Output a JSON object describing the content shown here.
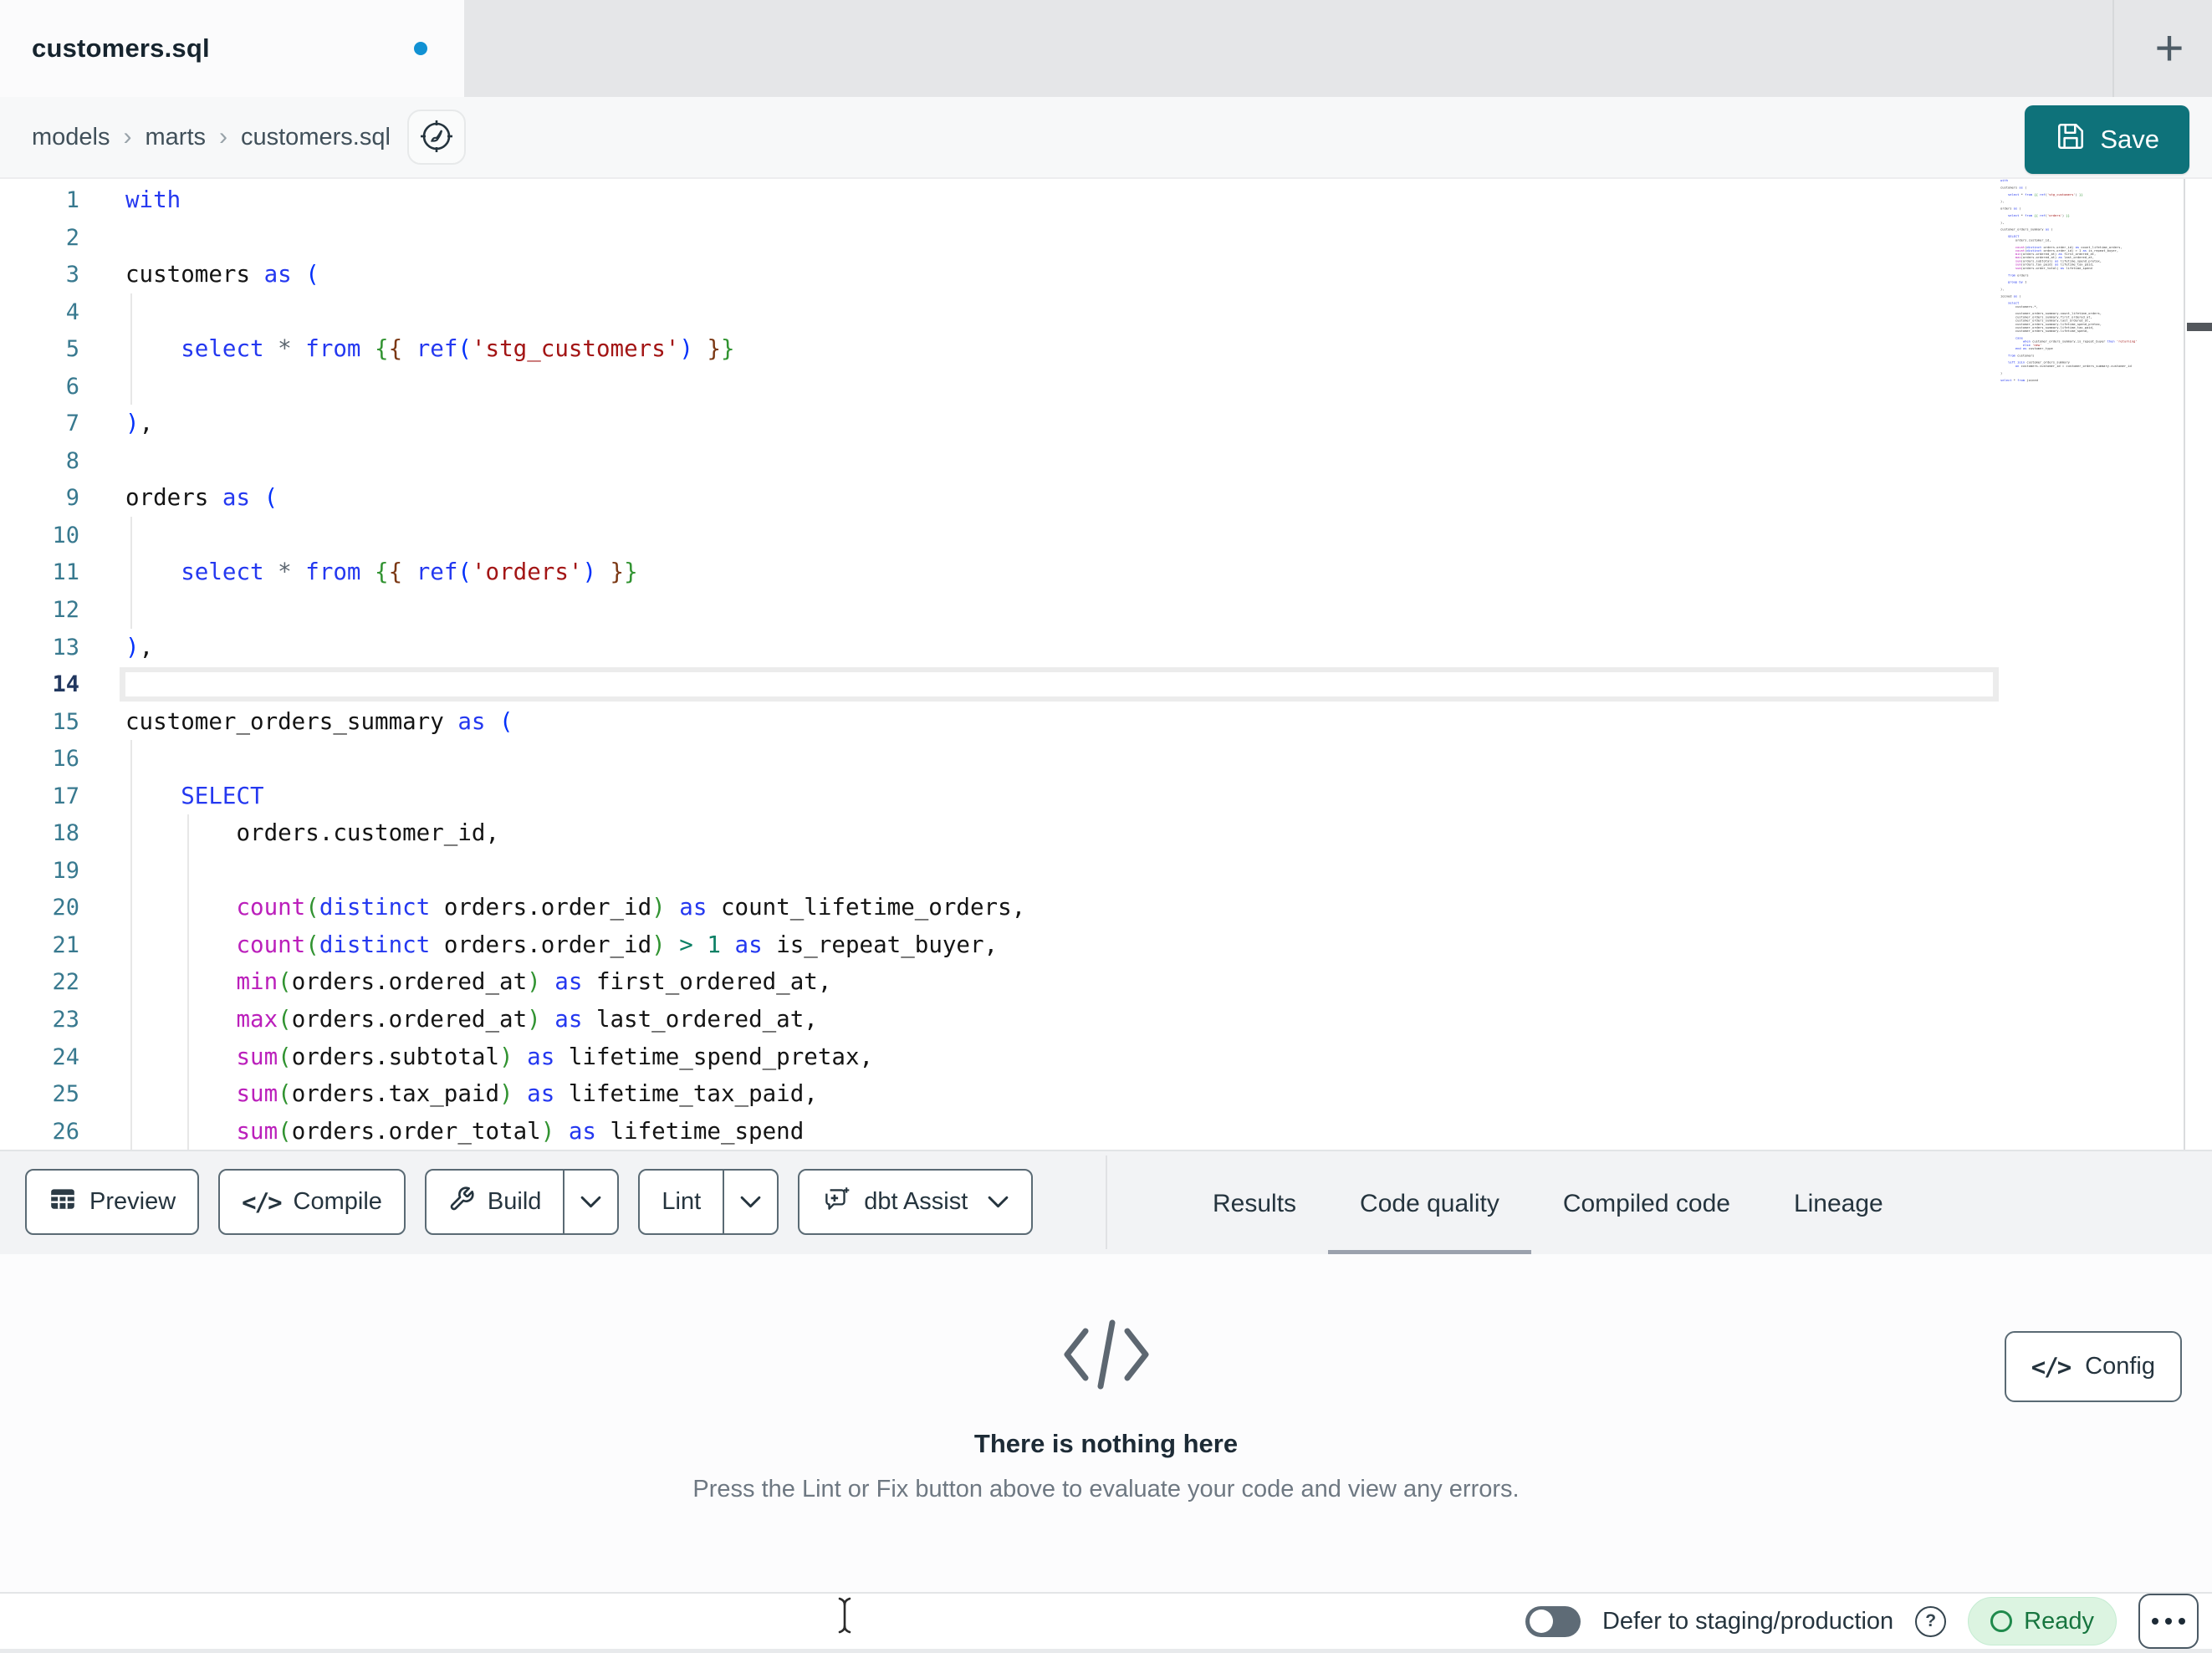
{
  "tab_bar": {
    "file_name": "customers.sql",
    "unsaved": true,
    "new_tab_label": "+"
  },
  "breadcrumb": {
    "items": [
      "models",
      "marts",
      "customers.sql"
    ],
    "separator": "›"
  },
  "actions": {
    "save": "Save",
    "config": "Config"
  },
  "toolbar": {
    "preview": "Preview",
    "compile": "Compile",
    "build": "Build",
    "lint": "Lint",
    "assist": "dbt Assist"
  },
  "panel_tabs": [
    {
      "label": "Results",
      "active": false
    },
    {
      "label": "Code quality",
      "active": true
    },
    {
      "label": "Compiled code",
      "active": false
    },
    {
      "label": "Lineage",
      "active": false
    }
  ],
  "empty_state": {
    "title": "There is nothing here",
    "description": "Press the Lint or Fix button above to evaluate your code and view any errors."
  },
  "status_bar": {
    "defer_label": "Defer to staging/production",
    "ready_label": "Ready",
    "toggle_on": false
  },
  "colors": {
    "accent_teal": "#0e727a",
    "unsaved_blue": "#1191d3",
    "ready_green": "#17753f",
    "ready_bg": "#dcf4e1",
    "line_number": "#38798f",
    "keyword": "#2438f0",
    "function": "#bb1fbb",
    "string": "#a31515",
    "jinja_bracket_green": "#319331",
    "bracket_blue": "#0431fa",
    "bracket_brown": "#7b3814",
    "active_tab_underline": "#9ba1ad"
  },
  "editor": {
    "current_line": 14,
    "lines": [
      {
        "n": 1,
        "g": [],
        "seg": [
          [
            "k",
            "with"
          ]
        ]
      },
      {
        "n": 2,
        "g": [],
        "seg": []
      },
      {
        "n": 3,
        "g": [],
        "seg": [
          [
            "p",
            "customers "
          ],
          [
            "k",
            "as"
          ],
          [
            "b1",
            " ("
          ]
        ]
      },
      {
        "n": 4,
        "g": [
          1
        ],
        "seg": []
      },
      {
        "n": 5,
        "g": [
          1
        ],
        "seg": [
          [
            "p",
            "    "
          ],
          [
            "k",
            "select"
          ],
          [
            "o",
            " *"
          ],
          [
            "k",
            " from"
          ],
          [
            "b2",
            " {"
          ],
          [
            "b3",
            "{"
          ],
          [
            "k",
            " ref"
          ],
          [
            "b1",
            "("
          ],
          [
            "s",
            "'stg_customers'"
          ],
          [
            "b1",
            ")"
          ],
          [
            "b3",
            " }"
          ],
          [
            "b2",
            "}"
          ]
        ]
      },
      {
        "n": 6,
        "g": [
          1
        ],
        "seg": []
      },
      {
        "n": 7,
        "g": [],
        "seg": [
          [
            "b1",
            ")"
          ],
          [
            "p",
            ","
          ]
        ]
      },
      {
        "n": 8,
        "g": [],
        "seg": []
      },
      {
        "n": 9,
        "g": [],
        "seg": [
          [
            "p",
            "orders "
          ],
          [
            "k",
            "as"
          ],
          [
            "b1",
            " ("
          ]
        ]
      },
      {
        "n": 10,
        "g": [
          1
        ],
        "seg": []
      },
      {
        "n": 11,
        "g": [
          1
        ],
        "seg": [
          [
            "p",
            "    "
          ],
          [
            "k",
            "select"
          ],
          [
            "o",
            " *"
          ],
          [
            "k",
            " from"
          ],
          [
            "b2",
            " {"
          ],
          [
            "b3",
            "{"
          ],
          [
            "k",
            " ref"
          ],
          [
            "b1",
            "("
          ],
          [
            "s",
            "'orders'"
          ],
          [
            "b1",
            ")"
          ],
          [
            "b3",
            " }"
          ],
          [
            "b2",
            "}"
          ]
        ]
      },
      {
        "n": 12,
        "g": [
          1
        ],
        "seg": []
      },
      {
        "n": 13,
        "g": [],
        "seg": [
          [
            "b1",
            ")"
          ],
          [
            "p",
            ","
          ]
        ]
      },
      {
        "n": 14,
        "g": [],
        "seg": []
      },
      {
        "n": 15,
        "g": [],
        "seg": [
          [
            "p",
            "customer_orders_summary "
          ],
          [
            "k",
            "as"
          ],
          [
            "b1",
            " ("
          ]
        ]
      },
      {
        "n": 16,
        "g": [
          1
        ],
        "seg": []
      },
      {
        "n": 17,
        "g": [
          1
        ],
        "seg": [
          [
            "p",
            "    "
          ],
          [
            "k",
            "SELECT"
          ]
        ]
      },
      {
        "n": 18,
        "g": [
          1,
          2
        ],
        "seg": [
          [
            "p",
            "        orders.customer_id,"
          ]
        ]
      },
      {
        "n": 19,
        "g": [
          1,
          2
        ],
        "seg": []
      },
      {
        "n": 20,
        "g": [
          1,
          2
        ],
        "seg": [
          [
            "p",
            "        "
          ],
          [
            "f",
            "count"
          ],
          [
            "b2",
            "("
          ],
          [
            "k",
            "distinct"
          ],
          [
            "p",
            " orders.order_id"
          ],
          [
            "b2",
            ")"
          ],
          [
            "k",
            " as"
          ],
          [
            "p",
            " count_lifetime_orders,"
          ]
        ]
      },
      {
        "n": 21,
        "g": [
          1,
          2
        ],
        "seg": [
          [
            "p",
            "        "
          ],
          [
            "f",
            "count"
          ],
          [
            "b2",
            "("
          ],
          [
            "k",
            "distinct"
          ],
          [
            "p",
            " orders.order_id"
          ],
          [
            "b2",
            ")"
          ],
          [
            "n",
            " > 1"
          ],
          [
            "k",
            " as"
          ],
          [
            "p",
            " is_repeat_buyer,"
          ]
        ]
      },
      {
        "n": 22,
        "g": [
          1,
          2
        ],
        "seg": [
          [
            "p",
            "        "
          ],
          [
            "f",
            "min"
          ],
          [
            "b2",
            "("
          ],
          [
            "p",
            "orders.ordered_at"
          ],
          [
            "b2",
            ")"
          ],
          [
            "k",
            " as"
          ],
          [
            "p",
            " first_ordered_at,"
          ]
        ]
      },
      {
        "n": 23,
        "g": [
          1,
          2
        ],
        "seg": [
          [
            "p",
            "        "
          ],
          [
            "f",
            "max"
          ],
          [
            "b2",
            "("
          ],
          [
            "p",
            "orders.ordered_at"
          ],
          [
            "b2",
            ")"
          ],
          [
            "k",
            " as"
          ],
          [
            "p",
            " last_ordered_at,"
          ]
        ]
      },
      {
        "n": 24,
        "g": [
          1,
          2
        ],
        "seg": [
          [
            "p",
            "        "
          ],
          [
            "f",
            "sum"
          ],
          [
            "b2",
            "("
          ],
          [
            "p",
            "orders.subtotal"
          ],
          [
            "b2",
            ")"
          ],
          [
            "k",
            " as"
          ],
          [
            "p",
            " lifetime_spend_pretax,"
          ]
        ]
      },
      {
        "n": 25,
        "g": [
          1,
          2
        ],
        "seg": [
          [
            "p",
            "        "
          ],
          [
            "f",
            "sum"
          ],
          [
            "b2",
            "("
          ],
          [
            "p",
            "orders.tax_paid"
          ],
          [
            "b2",
            ")"
          ],
          [
            "k",
            " as"
          ],
          [
            "p",
            " lifetime_tax_paid,"
          ]
        ]
      },
      {
        "n": 26,
        "g": [
          1,
          2
        ],
        "seg": [
          [
            "p",
            "        "
          ],
          [
            "f",
            "sum"
          ],
          [
            "b2",
            "("
          ],
          [
            "p",
            "orders.order_total"
          ],
          [
            "b2",
            ")"
          ],
          [
            "k",
            " as"
          ],
          [
            "p",
            " lifetime_spend"
          ]
        ]
      }
    ],
    "minimap_lines": [
      "with",
      "",
      "customers as (",
      "",
      "    select * from {{ ref('stg_customers') }}",
      "",
      "),",
      "",
      "orders as (",
      "",
      "    select * from {{ ref('orders') }}",
      "",
      "),",
      "",
      "customer_orders_summary as (",
      "",
      "    SELECT",
      "        orders.customer_id,",
      "",
      "        count(distinct orders.order_id) as count_lifetime_orders,",
      "        count(distinct orders.order_id) > 1 as is_repeat_buyer,",
      "        min(orders.ordered_at) as first_ordered_at,",
      "        max(orders.ordered_at) as last_ordered_at,",
      "        sum(orders.subtotal) as lifetime_spend_pretax,",
      "        sum(orders.tax_paid) as lifetime_tax_paid,",
      "        sum(orders.order_total) as lifetime_spend",
      "",
      "    from orders",
      "",
      "    group by 1",
      "",
      "),",
      "",
      "joined as (",
      "",
      "    select",
      "        customers.*,",
      "",
      "        customer_orders_summary.count_lifetime_orders,",
      "        customer_orders_summary.first_ordered_at,",
      "        customer_orders_summary.last_ordered_at,",
      "        customer_orders_summary.lifetime_spend_pretax,",
      "        customer_orders_summary.lifetime_tax_paid,",
      "        customer_orders_summary.lifetime_spend,",
      "",
      "        case",
      "            when customer_orders_summary.is_repeat_buyer then 'returning'",
      "            else 'new'",
      "        end as customer_type",
      "",
      "    from customers",
      "",
      "    left join customer_orders_summary",
      "        on customers.customer_id = customer_orders_summary.customer_id",
      "",
      ")",
      "",
      "select * from joined"
    ]
  }
}
